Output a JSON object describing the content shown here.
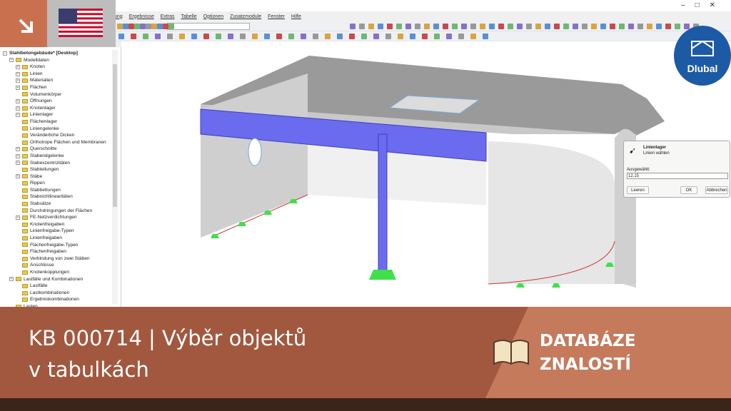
{
  "menu": [
    "ung",
    "Ergebnisse",
    "Extras",
    "Tabelle",
    "Optionen",
    "Zusatzmodule",
    "Fenster",
    "Hilfe"
  ],
  "tree": {
    "root": "Stahlbetongebäude* [Desktop]",
    "items": [
      {
        "label": "Modelldaten",
        "level": 1,
        "exp": true
      },
      {
        "label": "Knoten",
        "level": 2,
        "exp": true
      },
      {
        "label": "Linien",
        "level": 2,
        "exp": true
      },
      {
        "label": "Materialien",
        "level": 2,
        "exp": true
      },
      {
        "label": "Flächen",
        "level": 2,
        "exp": true
      },
      {
        "label": "Volumenkörper",
        "level": 2
      },
      {
        "label": "Öffnungen",
        "level": 2,
        "exp": true
      },
      {
        "label": "Knotenlager",
        "level": 2,
        "exp": true
      },
      {
        "label": "Linienlager",
        "level": 2,
        "exp": true
      },
      {
        "label": "Flächenlager",
        "level": 2
      },
      {
        "label": "Liniengelenke",
        "level": 2
      },
      {
        "label": "Veränderliche Dicken",
        "level": 2
      },
      {
        "label": "Orthotrope Flächen und Membranen",
        "level": 2
      },
      {
        "label": "Querschnitte",
        "level": 2,
        "exp": true
      },
      {
        "label": "Stabendgelenke",
        "level": 2,
        "exp": true
      },
      {
        "label": "Stabexzentrizitäten",
        "level": 2,
        "exp": true
      },
      {
        "label": "Stabteilungen",
        "level": 2
      },
      {
        "label": "Stäbe",
        "level": 2,
        "exp": true
      },
      {
        "label": "Rippen",
        "level": 2
      },
      {
        "label": "Stabbettungen",
        "level": 2
      },
      {
        "label": "Stabnichtlinearitäten",
        "level": 2
      },
      {
        "label": "Stabsätze",
        "level": 2
      },
      {
        "label": "Durchdringungen der Flächen",
        "level": 2
      },
      {
        "label": "FE-Netzverdichtungen",
        "level": 2,
        "exp": true
      },
      {
        "label": "Knotenfreigaben",
        "level": 2
      },
      {
        "label": "Linienfreigabe-Typen",
        "level": 2
      },
      {
        "label": "Linienfreigaben",
        "level": 2
      },
      {
        "label": "Flächenfreigabe-Typen",
        "level": 2
      },
      {
        "label": "Flächenfreigaben",
        "level": 2
      },
      {
        "label": "Verbindung von zwei Stäben",
        "level": 2
      },
      {
        "label": "Anschlüsse",
        "level": 2
      },
      {
        "label": "Knotenkopplungen",
        "level": 2
      },
      {
        "label": "Lastfälle und Kombinationen",
        "level": 1,
        "exp": true
      },
      {
        "label": "Lastfälle",
        "level": 2
      },
      {
        "label": "Lastkombinationen",
        "level": 2
      },
      {
        "label": "Ergebniskombinationen",
        "level": 2
      },
      {
        "label": "Lasten",
        "level": 1
      }
    ]
  },
  "dialog": {
    "title": "Linienlager",
    "subtitle": "Linien wählen",
    "selected_label": "Ausgewählt:",
    "selected_value": "12,15",
    "clear": "Leeren",
    "ok": "OK",
    "cancel": "Abbrechen"
  },
  "logo": "Dlubal",
  "banner": {
    "title_line1": "KB 000714 | Výběr objektů",
    "title_line2": "v tabulkách",
    "kb_line1": "DATABÁZE",
    "kb_line2": "ZNALOSTÍ"
  },
  "colors": {
    "accent": "#c9704f",
    "banner": "#a2583f",
    "member": "#6b6bf0",
    "support": "#3fe04a"
  }
}
